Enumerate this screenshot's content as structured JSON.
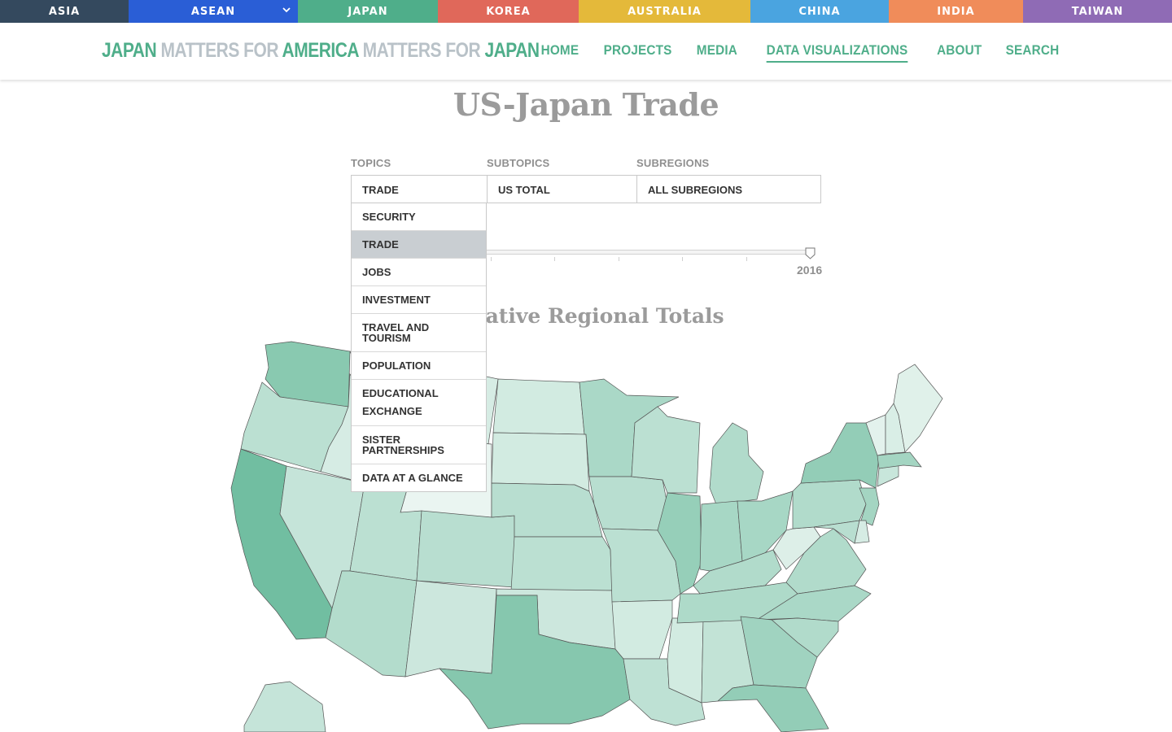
{
  "country_bar": [
    {
      "label": "ASIA",
      "color": "#34495e",
      "width": 158
    },
    {
      "label": "ASEAN",
      "color": "#2a5ed6",
      "width": 208,
      "has_dropdown": true
    },
    {
      "label": "JAPAN",
      "color": "#4fae8a",
      "width": 172
    },
    {
      "label": "KOREA",
      "color": "#e0685a",
      "width": 173
    },
    {
      "label": "AUSTRALIA",
      "color": "#e4b93a",
      "width": 211
    },
    {
      "label": "CHINA",
      "color": "#4aa4e0",
      "width": 170
    },
    {
      "label": "INDIA",
      "color": "#f08c5a",
      "width": 165
    },
    {
      "label": "TAIWAN",
      "color": "#8f6bb5",
      "width": 183
    }
  ],
  "header": {
    "brand": [
      {
        "text": "JAPAN",
        "style": "strong"
      },
      {
        "text": " MATTERS FOR ",
        "style": "light"
      },
      {
        "text": "AMERICA",
        "style": "strong"
      },
      {
        "text": " MATTERS FOR ",
        "style": "light"
      },
      {
        "text": "JAPAN",
        "style": "strong"
      }
    ],
    "nav": [
      {
        "label": "HOME",
        "active": false
      },
      {
        "label": "PROJECTS",
        "active": false
      },
      {
        "label": "MEDIA",
        "active": false
      },
      {
        "label": "DATA VISUALIZATIONS",
        "active": true
      },
      {
        "label": "ABOUT",
        "active": false
      },
      {
        "label": "SEARCH",
        "active": false
      }
    ]
  },
  "page_title": "US-Japan Trade",
  "filters": {
    "topics_label": "TOPICS",
    "subtopics_label": "SUBTOPICS",
    "subregions_label": "SUBREGIONS",
    "topic_value": "TRADE",
    "subtopic_value": "US TOTAL",
    "subregion_value": "ALL SUBREGIONS",
    "topic_options": [
      {
        "label": "SECURITY"
      },
      {
        "label": "TRADE",
        "selected": true
      },
      {
        "label": "JOBS"
      },
      {
        "label": "INVESTMENT"
      },
      {
        "label": "TRAVEL AND TOURISM"
      },
      {
        "label": "POPULATION"
      },
      {
        "label": "EDUCATIONAL EXCHANGE",
        "multiline": true
      },
      {
        "label": "SISTER PARTNERSHIPS"
      },
      {
        "label": "DATA AT A GLANCE"
      }
    ]
  },
  "slider": {
    "year": "2016"
  },
  "map_title": "Relative Regional Totals",
  "colors": {
    "accent": "#4fae8a",
    "muted": "#9b9b9b"
  },
  "map_states": [
    {
      "name": "WA",
      "level": 0.58
    },
    {
      "name": "OR",
      "level": 0.28
    },
    {
      "name": "CA",
      "level": 0.72
    },
    {
      "name": "NV",
      "level": 0.22
    },
    {
      "name": "ID",
      "level": 0.12
    },
    {
      "name": "UT",
      "level": 0.28
    },
    {
      "name": "AZ",
      "level": 0.33
    },
    {
      "name": "MT",
      "level": 0.12
    },
    {
      "name": "WY",
      "level": 0.0
    },
    {
      "name": "CO",
      "level": 0.3
    },
    {
      "name": "NM",
      "level": 0.18
    },
    {
      "name": "ND",
      "level": 0.14
    },
    {
      "name": "SD",
      "level": 0.14
    },
    {
      "name": "NE",
      "level": 0.3
    },
    {
      "name": "KS",
      "level": 0.28
    },
    {
      "name": "OK",
      "level": 0.18
    },
    {
      "name": "TX",
      "level": 0.6
    },
    {
      "name": "MN",
      "level": 0.38
    },
    {
      "name": "IA",
      "level": 0.3
    },
    {
      "name": "MO",
      "level": 0.28
    },
    {
      "name": "AR",
      "level": 0.14
    },
    {
      "name": "LA",
      "level": 0.26
    },
    {
      "name": "WI",
      "level": 0.28
    },
    {
      "name": "IL",
      "level": 0.5
    },
    {
      "name": "MS",
      "level": 0.14
    },
    {
      "name": "AL",
      "level": 0.24
    },
    {
      "name": "MI",
      "level": 0.34
    },
    {
      "name": "IN",
      "level": 0.4
    },
    {
      "name": "KY",
      "level": 0.34
    },
    {
      "name": "TN",
      "level": 0.36
    },
    {
      "name": "OH",
      "level": 0.4
    },
    {
      "name": "WV",
      "level": 0.08
    },
    {
      "name": "VA",
      "level": 0.34
    },
    {
      "name": "NC",
      "level": 0.38
    },
    {
      "name": "SC",
      "level": 0.34
    },
    {
      "name": "GA",
      "level": 0.44
    },
    {
      "name": "FL",
      "level": 0.52
    },
    {
      "name": "PA",
      "level": 0.34
    },
    {
      "name": "NY",
      "level": 0.52
    },
    {
      "name": "NJ",
      "level": 0.42
    },
    {
      "name": "MD",
      "level": 0.3
    },
    {
      "name": "DE",
      "level": 0.12
    },
    {
      "name": "CT",
      "level": 0.2
    },
    {
      "name": "MA",
      "level": 0.42
    },
    {
      "name": "VT",
      "level": 0.04
    },
    {
      "name": "NH",
      "level": 0.1
    },
    {
      "name": "ME",
      "level": 0.06
    },
    {
      "name": "AK",
      "level": 0.22
    }
  ]
}
